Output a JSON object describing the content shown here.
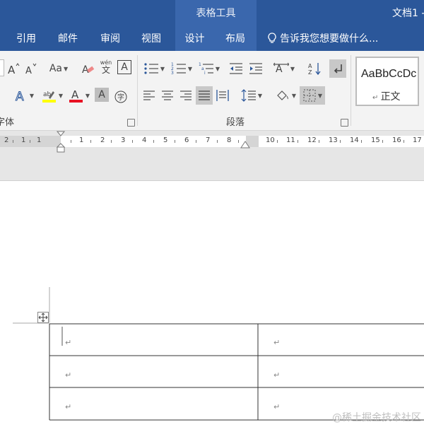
{
  "titlebar": {
    "context_group": "表格工具",
    "document_title": "文档1 -"
  },
  "tabs": [
    {
      "label": "引用"
    },
    {
      "label": "邮件"
    },
    {
      "label": "审阅"
    },
    {
      "label": "视图"
    },
    {
      "label": "设计"
    },
    {
      "label": "布局"
    }
  ],
  "tell_me": {
    "label": "告诉我您想要做什么..."
  },
  "ribbon": {
    "font_group_label": "字体",
    "paragraph_group_label": "段落",
    "phonetic_top": "wén",
    "phonetic_bottom": "文",
    "change_case": "Aa",
    "style_sample": "AaBbCcDc",
    "style_name": "正文",
    "colors": {
      "highlight": "#ffff00",
      "font_color": "#e81123"
    }
  },
  "ruler": {
    "left_numbers": [
      "2",
      "1",
      "1"
    ],
    "right_numbers": [
      "1",
      "2",
      "3",
      "4",
      "5",
      "6",
      "7",
      "8"
    ],
    "far_numbers": [
      "10",
      "11",
      "12",
      "13",
      "14",
      "15",
      "16",
      "17"
    ]
  },
  "table": {
    "rows": [
      [
        "↵",
        "↵"
      ],
      [
        "↵",
        "↵"
      ],
      [
        "↵",
        "↵"
      ]
    ],
    "move_handle": "✥"
  },
  "watermark": "@稀土掘金技术社区"
}
